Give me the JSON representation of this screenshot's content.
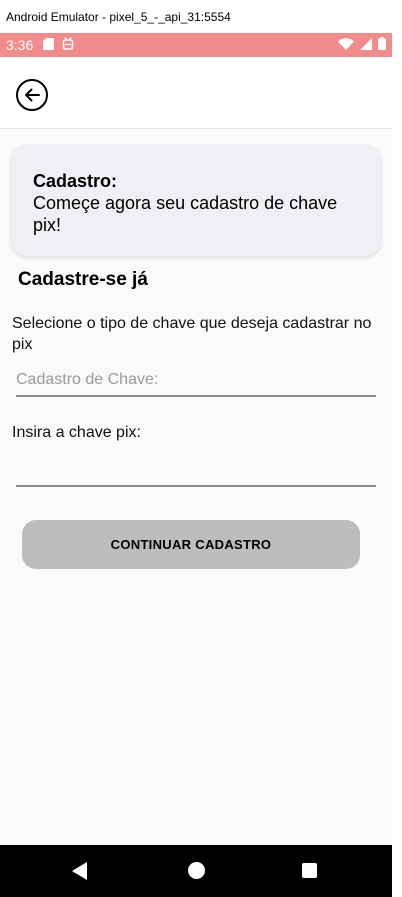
{
  "window": {
    "title": "Android Emulator - pixel_5_-_api_31:5554"
  },
  "statusbar": {
    "time": "3:36",
    "color": "#f28b8b"
  },
  "card": {
    "title": "Cadastro:",
    "text": "Começe agora seu cadastro de chave pix!"
  },
  "form": {
    "section_title": "Cadastre-se já",
    "type_label": "Selecione o tipo de chave que deseja cadastrar no pix",
    "type_placeholder": "Cadastro de Chave:",
    "pix_label": "Insira a chave pix:",
    "pix_value": "",
    "continue_label": "CONTINUAR CADASTRO"
  },
  "icons": {
    "back": "back-arrow-icon",
    "nav_back": "triangle-back-icon",
    "nav_home": "circle-home-icon",
    "nav_recent": "square-recent-icon"
  }
}
